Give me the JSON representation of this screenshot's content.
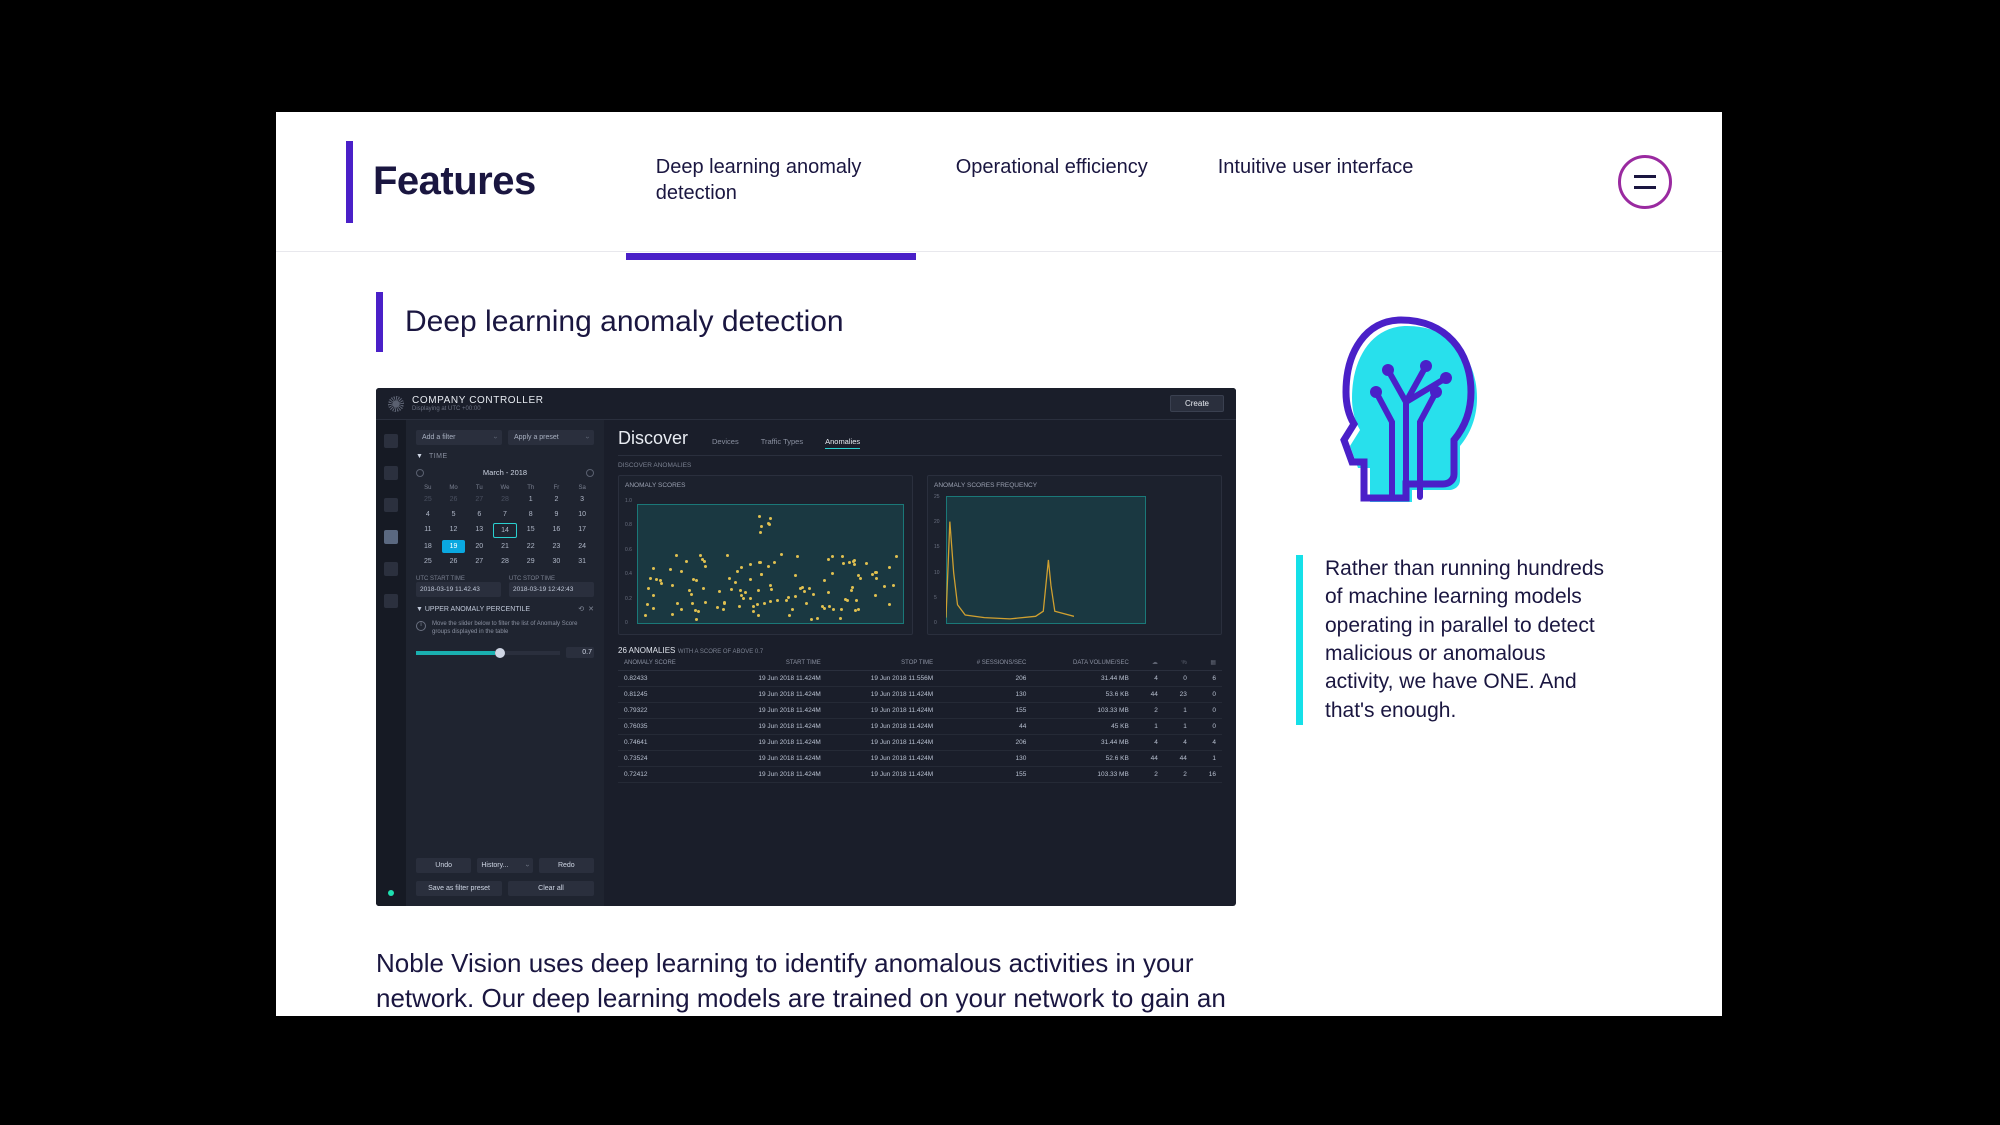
{
  "header": {
    "title": "Features",
    "tabs": [
      {
        "label": "Deep learning anomaly detection",
        "active": true
      },
      {
        "label": "Operational efficiency",
        "active": false
      },
      {
        "label": "Intuitive user interface",
        "active": false
      }
    ]
  },
  "section": {
    "title": "Deep learning anomaly detection"
  },
  "description": "Noble Vision uses deep learning to identify anomalous activities in your network. Our deep learning models are trained on your network to gain an understanding",
  "quote": "Rather than running hundreds of machine learning models operating in parallel to detect malicious or anomalous activity, we have ONE. And that's enough.",
  "dashboard": {
    "brand": "COMPANY CONTROLLER",
    "brand_sub": "Displaying at UTC +00:00",
    "create": "Create",
    "filter_add": "Add a filter",
    "filter_preset": "Apply a preset",
    "time_label": "TIME",
    "month": "March - 2018",
    "dow": [
      "Su",
      "Mo",
      "Tu",
      "We",
      "Th",
      "Fr",
      "Sa"
    ],
    "days_pre": [
      25,
      26,
      27,
      28
    ],
    "days": [
      1,
      2,
      3,
      4,
      5,
      6,
      7,
      8,
      9,
      10,
      11,
      12,
      13,
      14,
      15,
      16,
      17,
      18,
      19,
      20,
      21,
      22,
      23,
      24,
      25,
      26,
      27,
      28,
      29,
      30,
      31
    ],
    "day_sel": 14,
    "day_cur": 19,
    "utc_start_lbl": "UTC START TIME",
    "utc_stop_lbl": "UTC STOP TIME",
    "utc_start": "2018-03-19 11.42.43",
    "utc_stop": "2018-03-19 12:42:43",
    "upper_lbl": "UPPER ANOMALY PERCENTILE",
    "upper_help": "Move the slider below to filter the list of Anomaly Score groups displayed in the table",
    "upper_val": "0.7",
    "btn_undo": "Undo",
    "btn_history": "History...",
    "btn_redo": "Redo",
    "btn_save": "Save as filter preset",
    "btn_clear": "Clear all",
    "discover_title": "Discover",
    "discover_tabs": [
      "Devices",
      "Traffic Types",
      "Anomalies"
    ],
    "discover_sub": "DISCOVER ANOMALIES",
    "chart1_title": "ANOMALY SCORES",
    "chart2_title": "ANOMALY SCORES FREQUENCY",
    "anomaly_count": "26 ANOMALIES",
    "anomaly_sub": "WITH A SCORE OF ABOVE 0.7",
    "columns": [
      "ANOMALY SCORE",
      "START TIME",
      "STOP TIME",
      "# SESSIONS/SEC",
      "DATA VOLUME/SEC",
      "",
      "",
      ""
    ],
    "col_icons": [
      "cloud",
      "percent",
      "grid"
    ],
    "rows": [
      {
        "score": "0.82433",
        "start": "19 Jun 2018 11.424M",
        "stop": "19 Jun 2018 11.556M",
        "sess": "206",
        "vol": "31.44 MB",
        "a": "4",
        "b": "0",
        "c": "6"
      },
      {
        "score": "0.81245",
        "start": "19 Jun 2018 11.424M",
        "stop": "19 Jun 2018 11.424M",
        "sess": "130",
        "vol": "53.6 KB",
        "a": "44",
        "b": "23",
        "c": "0"
      },
      {
        "score": "0.79322",
        "start": "19 Jun 2018 11.424M",
        "stop": "19 Jun 2018 11.424M",
        "sess": "155",
        "vol": "103.33 MB",
        "a": "2",
        "b": "1",
        "c": "0"
      },
      {
        "score": "0.76035",
        "start": "19 Jun 2018 11.424M",
        "stop": "19 Jun 2018 11.424M",
        "sess": "44",
        "vol": "45 KB",
        "a": "1",
        "b": "1",
        "c": "0"
      },
      {
        "score": "0.74641",
        "start": "19 Jun 2018 11.424M",
        "stop": "19 Jun 2018 11.424M",
        "sess": "206",
        "vol": "31.44 MB",
        "a": "4",
        "b": "4",
        "c": "4"
      },
      {
        "score": "0.73524",
        "start": "19 Jun 2018 11.424M",
        "stop": "19 Jun 2018 11.424M",
        "sess": "130",
        "vol": "52.6 KB",
        "a": "44",
        "b": "44",
        "c": "1"
      },
      {
        "score": "0.72412",
        "start": "19 Jun 2018 11.424M",
        "stop": "19 Jun 2018 11.424M",
        "sess": "155",
        "vol": "103.33 MB",
        "a": "2",
        "b": "2",
        "c": "16"
      }
    ]
  }
}
